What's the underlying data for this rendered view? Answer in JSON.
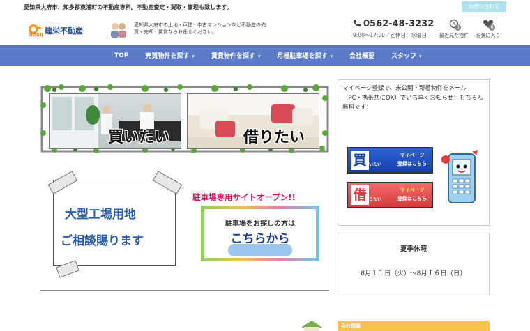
{
  "topbar": {
    "tagline": "愛知県大府市、知多郡東浦町の不動産専科。不動産査定・買取・管理も致します。",
    "contact_button": "お問い合わせ"
  },
  "header": {
    "logo_name": "建栄不動産",
    "logo_sub": "株式会社",
    "description": "愛知県大府市の土地・戸建・中古マンションなど不動産の売買・売却・賃貸ならお任せください。",
    "phone": "0562-48-3232",
    "hours": "9:00～17:00／定休日：水曜日",
    "history_label": "最近見た物件",
    "history_count": "0",
    "favorites_label": "お気に入り",
    "favorites_count": "0"
  },
  "nav": {
    "items": [
      {
        "label": "TOP",
        "dropdown": false
      },
      {
        "label": "売買物件を探す",
        "dropdown": true
      },
      {
        "label": "賃貸物件を探す",
        "dropdown": true
      },
      {
        "label": "月極駐車場を探す",
        "dropdown": true
      },
      {
        "label": "会社概要",
        "dropdown": false
      },
      {
        "label": "スタッフ",
        "dropdown": true
      }
    ]
  },
  "banners": {
    "buy_label": "買いたい",
    "rent_label": "借りたい",
    "factory_line1": "大型工場用地",
    "factory_line2": "ご相談賜ります",
    "parking_title": "駐車場専用サイトオープン!!",
    "parking_sub": "駐車場をお探しの方は",
    "parking_cta": "こちらから"
  },
  "sidebar": {
    "mypage_text": "マイページ登録で、未公開・新着物件をメール（PC・携帯共にOK）でいち早くお知らせ！もちろん無料です！",
    "mypage_buy_big": "買",
    "mypage_buy_small": "いたい",
    "mypage_rent_big": "借",
    "mypage_rent_small": "りたい",
    "mypage_line1": "マイページ",
    "mypage_line2": "登録はこちら",
    "notice_title": "夏季休暇",
    "notice_body": "8月１１日（火）～8月１６日（日）",
    "company_heading": "会社情報"
  },
  "colors": {
    "nav": "#5b7bc9",
    "contact_button": "#aee3ee",
    "accent_blue": "#2a5fa8",
    "accent_pink": "#d4145a"
  }
}
